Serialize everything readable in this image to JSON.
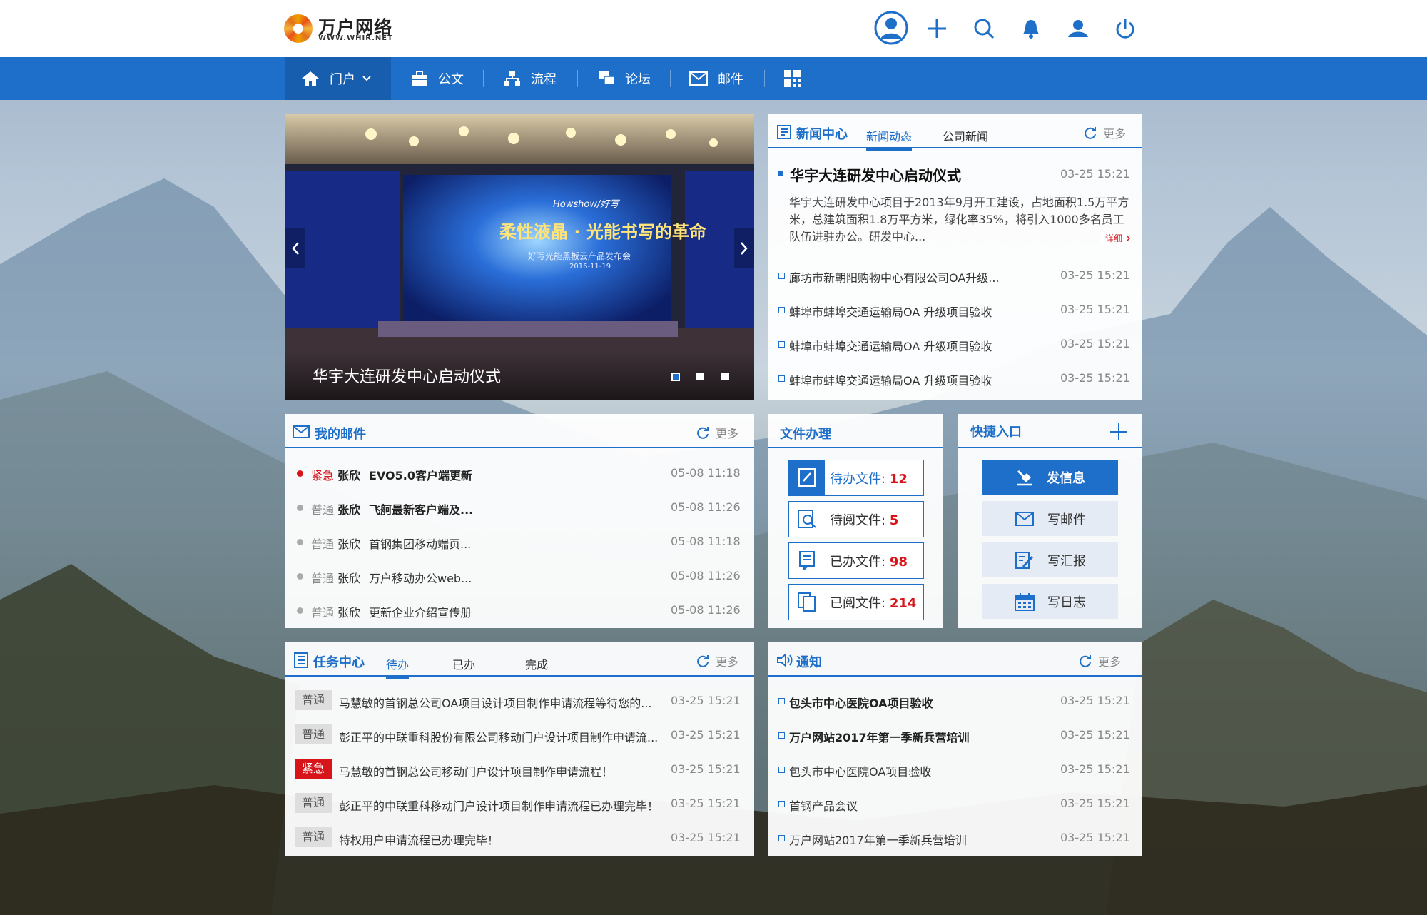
{
  "app": {
    "logo_cn": "万户网络",
    "logo_en": "WWW.WHIR.NET"
  },
  "header_icons": [
    "user-avatar-icon",
    "plus-icon",
    "search-icon",
    "bell-icon",
    "contacts-icon",
    "power-icon"
  ],
  "nav": {
    "items": [
      {
        "label": "门户",
        "icon": "home-icon"
      },
      {
        "label": "公文",
        "icon": "briefcase-icon"
      },
      {
        "label": "流程",
        "icon": "flow-icon"
      },
      {
        "label": "论坛",
        "icon": "forum-icon"
      },
      {
        "label": "邮件",
        "icon": "mail-icon"
      }
    ],
    "grid_icon": "apps-grid-icon"
  },
  "banner": {
    "caption": "华宇大连研发中心启动仪式",
    "stage_brand": "Howshow/好写",
    "stage_headline": "柔性液晶 · 光能书写的革命",
    "stage_sub": "好写光能黑板云产品发布会",
    "stage_date": "2016-11-19",
    "slides": 3,
    "active_slide": 1
  },
  "news": {
    "title": "新闻中心",
    "tabs": [
      "新闻动态",
      "公司新闻"
    ],
    "active_tab": 0,
    "more": "更多",
    "featured": {
      "title": "华宇大连研发中心启动仪式",
      "date": "03-25 15:21",
      "summary": "华宇大连研发中心项目于2013年9月开工建设，占地面积1.5万平方米，总建筑面积1.8万平方米，绿化率35%，将引入1000多名员工队伍进驻办公。研发中心...",
      "detail": "详细"
    },
    "items": [
      {
        "title": "廊坊市新朝阳购物中心有限公司OA升级...",
        "date": "03-25 15:21"
      },
      {
        "title": "蚌埠市蚌埠交通运输局OA 升级项目验收",
        "date": "03-25 15:21"
      },
      {
        "title": "蚌埠市蚌埠交通运输局OA 升级项目验收",
        "date": "03-25 15:21"
      },
      {
        "title": "蚌埠市蚌埠交通运输局OA 升级项目验收",
        "date": "03-25 15:21"
      }
    ]
  },
  "mail": {
    "title": "我的邮件",
    "more": "更多",
    "items": [
      {
        "level": "紧急",
        "sender": "张欣",
        "subject": "EVO5.0客户端更新",
        "date": "05-08 11:18",
        "urgent": true,
        "bold": true
      },
      {
        "level": "普通",
        "sender": "张欣",
        "subject": "飞舸最新客户端及...",
        "date": "05-08 11:26",
        "urgent": false,
        "bold": true
      },
      {
        "level": "普通",
        "sender": "张欣",
        "subject": "首钢集团移动端页...",
        "date": "05-08 11:18",
        "urgent": false,
        "bold": false
      },
      {
        "level": "普通",
        "sender": "张欣",
        "subject": "万户移动办公web...",
        "date": "05-08 11:26",
        "urgent": false,
        "bold": false
      },
      {
        "level": "普通",
        "sender": "张欣",
        "subject": "更新企业介绍宣传册",
        "date": "05-08 11:26",
        "urgent": false,
        "bold": false
      }
    ]
  },
  "files": {
    "title": "文件办理",
    "items": [
      {
        "label": "待办文件:",
        "count": "12",
        "icon": "edit-doc-icon",
        "highlight": true
      },
      {
        "label": "待阅文件:",
        "count": "5",
        "icon": "read-doc-icon",
        "highlight": false
      },
      {
        "label": "已办文件:",
        "count": "98",
        "icon": "done-doc-icon",
        "highlight": false
      },
      {
        "label": "已阅文件:",
        "count": "214",
        "icon": "copy-doc-icon",
        "highlight": false
      }
    ]
  },
  "quick": {
    "title": "快捷入口",
    "items": [
      {
        "label": "发信息",
        "icon": "send-message-icon"
      },
      {
        "label": "写邮件",
        "icon": "write-mail-icon"
      },
      {
        "label": "写汇报",
        "icon": "write-report-icon"
      },
      {
        "label": "写日志",
        "icon": "calendar-icon"
      }
    ]
  },
  "tasks": {
    "title": "任务中心",
    "tabs": [
      "待办",
      "已办",
      "完成"
    ],
    "active_tab": 0,
    "more": "更多",
    "items": [
      {
        "level": "普通",
        "text": "马慧敏的首钢总公司OA项目设计项目制作申请流程等待您的...",
        "date": "03-25 15:21",
        "urgent": false
      },
      {
        "level": "普通",
        "text": "彭正平的中联重科股份有限公司移动门户设计项目制作申请流...",
        "date": "03-25 15:21",
        "urgent": false
      },
      {
        "level": "紧急",
        "text": "马慧敏的首钢总公司移动门户设计项目制作申请流程！",
        "date": "03-25 15:21",
        "urgent": true
      },
      {
        "level": "普通",
        "text": "彭正平的中联重科移动门户设计项目制作申请流程已办理完毕！",
        "date": "03-25 15:21",
        "urgent": false
      },
      {
        "level": "普通",
        "text": "特权用户申请流程已办理完毕！",
        "date": "03-25 15:21",
        "urgent": false
      }
    ]
  },
  "notice": {
    "title": "通知",
    "more": "更多",
    "items": [
      {
        "title": "包头市中心医院OA项目验收",
        "date": "03-25 15:21",
        "bold": true
      },
      {
        "title": "万户网站2017年第一季新兵营培训",
        "date": "03-25 15:21",
        "bold": true
      },
      {
        "title": "包头市中心医院OA项目验收",
        "date": "03-25 15:21",
        "bold": false
      },
      {
        "title": "首钢产品会议",
        "date": "03-25 15:21",
        "bold": false
      },
      {
        "title": "万户网站2017年第一季新兵营培训",
        "date": "03-25 15:21",
        "bold": false
      }
    ]
  },
  "colors": {
    "primary": "#1e6fc9",
    "urgent": "#d7141a"
  }
}
